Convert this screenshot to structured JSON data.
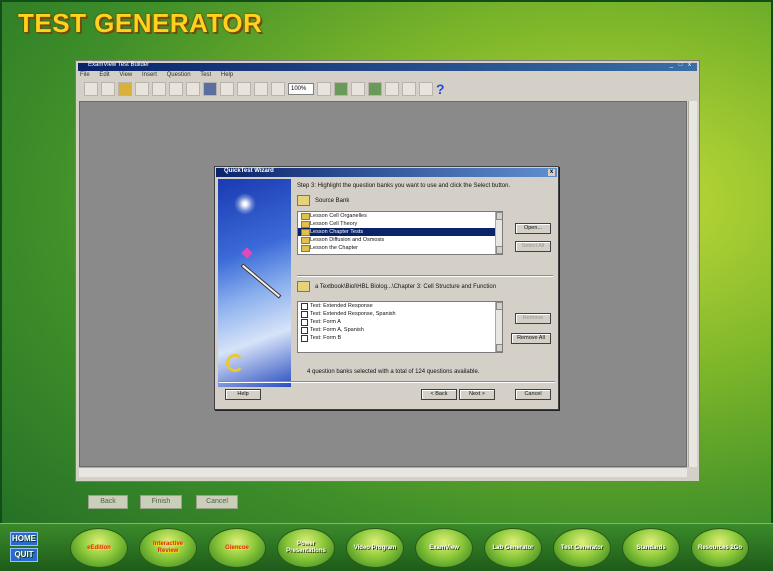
{
  "header": {
    "title": "TEST GENERATOR"
  },
  "app": {
    "title": "ExamView Test Builder",
    "window_controls": "_ □ x",
    "menu": [
      "File",
      "Edit",
      "View",
      "Insert",
      "Question",
      "Test",
      "Help"
    ],
    "zoom": "100%"
  },
  "wizard": {
    "title": "QuickTest Wizard",
    "close": "x",
    "step_text": "Step 3: Highlight the question banks you want to use and click the Select button.",
    "source_label": "Source Bank",
    "banks": [
      "Lesson Cell Organelles",
      "Lesson Cell Theory",
      "Lesson Chapter Tests",
      "Lesson Diffusion and Osmosis",
      "Lesson the Chapter"
    ],
    "selected_bank_index": 2,
    "open_button": "Open...",
    "select_button": "Select All",
    "path_label": "a Textbook\\Biol\\HBL Biolog...\\Chapter 3: Cell Structure and Function",
    "tests": [
      "Test: Extended Response",
      "Test: Extended Response, Spanish",
      "Test: Form A",
      "Test: Form A, Spanish",
      "Test: Form B"
    ],
    "remove_button": "Remove",
    "remove_all_button": "Remove All",
    "status": "4 question banks selected with a total of 124 questions available.",
    "help_button": "Help",
    "back_button": "< Back",
    "next_button": "Next >",
    "cancel_button": "Cancel"
  },
  "bottom_buttons": [
    "Back",
    "Finish",
    "Cancel"
  ],
  "nav": {
    "home": "HOME",
    "quit": "QUIT",
    "items": [
      {
        "label": "eEdition",
        "color": "red"
      },
      {
        "label": "Interactive Review",
        "color": "red"
      },
      {
        "label": "Glencoe",
        "color": "red"
      },
      {
        "label": "Power Presentations",
        "color": "white"
      },
      {
        "label": "Video Program",
        "color": "white"
      },
      {
        "label": "ExamView",
        "color": "white"
      },
      {
        "label": "Lab Generator",
        "color": "white"
      },
      {
        "label": "Test Generator",
        "color": "white"
      },
      {
        "label": "Standards",
        "color": "white"
      },
      {
        "label": "Resources 2Go",
        "color": "white"
      }
    ]
  }
}
